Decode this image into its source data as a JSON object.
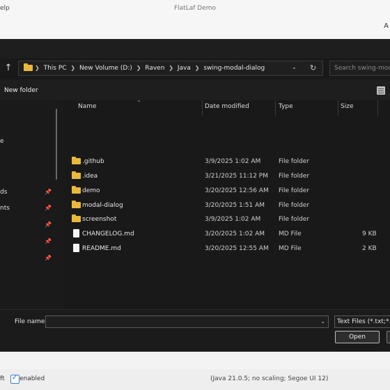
{
  "app": {
    "title": "FlatLaf Demo",
    "menu_help": "elp",
    "toolbar_right": "A",
    "footer": {
      "left_text": "ft",
      "enabled_label": "enabled",
      "enabled_checked": true,
      "java_info": "(Java 21.0.5; no scaling; Segoe UI 12)"
    }
  },
  "dialog": {
    "breadcrumb": [
      "This PC",
      "New Volume (D:)",
      "Raven",
      "Java",
      "swing-modal-dialog"
    ],
    "search_placeholder": "Search swing-moda",
    "new_folder_label": "New folder",
    "nav_items": [
      {
        "label": "e",
        "pinned": false
      },
      {
        "label": "ds",
        "pinned": true
      },
      {
        "label": "nts",
        "pinned": true
      },
      {
        "label": "",
        "pinned": true
      },
      {
        "label": "",
        "pinned": true
      },
      {
        "label": "",
        "pinned": true
      }
    ],
    "columns": {
      "name": "Name",
      "date": "Date modified",
      "type": "Type",
      "size": "Size"
    },
    "files": [
      {
        "name": ".github",
        "date": "3/9/2025 1:02 AM",
        "type": "File folder",
        "size": "",
        "kind": "folder"
      },
      {
        "name": ".idea",
        "date": "3/21/2025 11:12 PM",
        "type": "File folder",
        "size": "",
        "kind": "folder"
      },
      {
        "name": "demo",
        "date": "3/20/2025 12:56 AM",
        "type": "File folder",
        "size": "",
        "kind": "folder"
      },
      {
        "name": "modal-dialog",
        "date": "3/20/2025 1:51 AM",
        "type": "File folder",
        "size": "",
        "kind": "folder"
      },
      {
        "name": "screenshot",
        "date": "3/9/2025 1:02 AM",
        "type": "File folder",
        "size": "",
        "kind": "folder"
      },
      {
        "name": "CHANGELOG.md",
        "date": "3/20/2025 1:02 AM",
        "type": "MD File",
        "size": "9 KB",
        "kind": "file"
      },
      {
        "name": "README.md",
        "date": "3/20/2025 12:55 AM",
        "type": "MD File",
        "size": "2 KB",
        "kind": "file"
      }
    ],
    "file_name_label": "File name:",
    "file_name_value": "",
    "filter_label": "Text Files (*.txt;*.md",
    "open_label": "Open"
  },
  "colors": {
    "folder": "#e9b93b",
    "dialog_bg": "#1e1e1e",
    "accent": "#3b7bd4"
  }
}
